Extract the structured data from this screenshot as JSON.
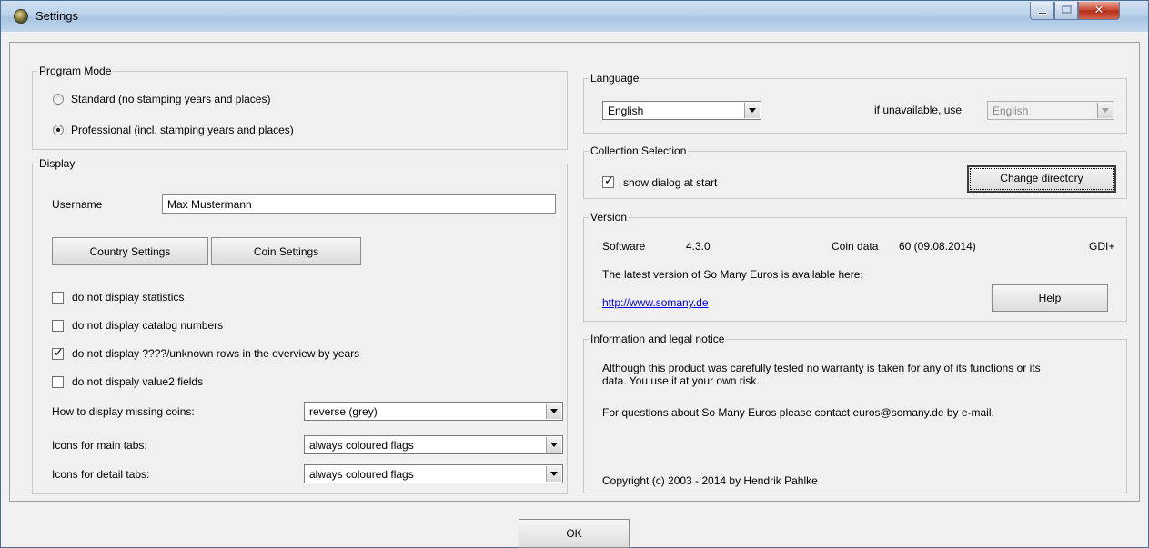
{
  "window": {
    "title": "Settings"
  },
  "program_mode": {
    "legend": "Program Mode",
    "standard": "Standard (no stamping years and places)",
    "professional": "Professional (incl. stamping years and places)",
    "selected": "professional"
  },
  "display": {
    "legend": "Display",
    "username_label": "Username",
    "username_value": "Max Mustermann",
    "country_settings": "Country Settings",
    "coin_settings": "Coin Settings",
    "checkboxes": [
      {
        "label": "do not display statistics",
        "checked": false
      },
      {
        "label": "do not display catalog numbers",
        "checked": false
      },
      {
        "label": "do not display ????/unknown rows in the overview by years",
        "checked": true
      },
      {
        "label": "do not dispaly value2 fields",
        "checked": false
      }
    ],
    "missing_coins_label": "How to display missing coins:",
    "missing_coins_value": "reverse (grey)",
    "main_tabs_label": "Icons for main tabs:",
    "main_tabs_value": "always coloured flags",
    "detail_tabs_label": "Icons for detail tabs:",
    "detail_tabs_value": "always coloured flags"
  },
  "language": {
    "legend": "Language",
    "selected": "English",
    "fallback_label": "if unavailable, use",
    "fallback_value": "English"
  },
  "collection": {
    "legend": "Collection Selection",
    "show_dialog_label": "show dialog at start",
    "show_dialog_checked": true,
    "change_directory": "Change directory"
  },
  "version": {
    "legend": "Version",
    "software_label": "Software",
    "software_value": "4.3.0",
    "coin_data_label": "Coin data",
    "coin_data_value": "60 (09.08.2014)",
    "renderer": "GDI+",
    "latest_text": "The latest version of So Many Euros is available here:",
    "link": "http://www.somany.de",
    "help": "Help"
  },
  "info": {
    "legend": "Information and legal notice",
    "warranty_line1": "Although this product was carefully tested no warranty is taken for any of its functions or its",
    "warranty_line2": "data. You use it at your own risk.",
    "contact": "For questions about So Many Euros please contact euros@somany.de by e-mail.",
    "copyright": "Copyright (c) 2003 - 2014 by Hendrik Pahlke"
  },
  "ok_button": "OK",
  "icons": {
    "app": "coin-icon",
    "minimize": "minimize-icon",
    "maximize": "maximize-icon",
    "close": "close-icon"
  }
}
